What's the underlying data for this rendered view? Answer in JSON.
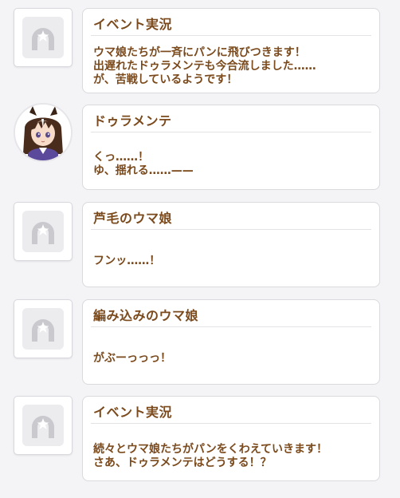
{
  "messages": [
    {
      "speaker": "イベント実況",
      "text": "ウマ娘たちが一斉にパンに飛びつきます！\n出遅れたドゥラメンテも今合流しました……\nが、苦戦しているようです！",
      "avatar": "horseshoe-placeholder-icon"
    },
    {
      "speaker": "ドゥラメンテ",
      "text": "くっ……！\nゆ、揺れる……——",
      "avatar": "duramente-portrait"
    },
    {
      "speaker": "芦毛のウマ娘",
      "text": "フンッ……！",
      "avatar": "horseshoe-placeholder-icon"
    },
    {
      "speaker": "編み込みのウマ娘",
      "text": "がぶーっっっ！",
      "avatar": "horseshoe-placeholder-icon"
    },
    {
      "speaker": "イベント実況",
      "text": "続々とウマ娘たちがパンをくわえていきます！\nさあ、ドゥラメンテはどうする！？",
      "avatar": "horseshoe-placeholder-icon"
    }
  ],
  "colors": {
    "text": "#7b4a1c",
    "background": "#f4f4f6",
    "bubble_border": "#d9d9de"
  }
}
